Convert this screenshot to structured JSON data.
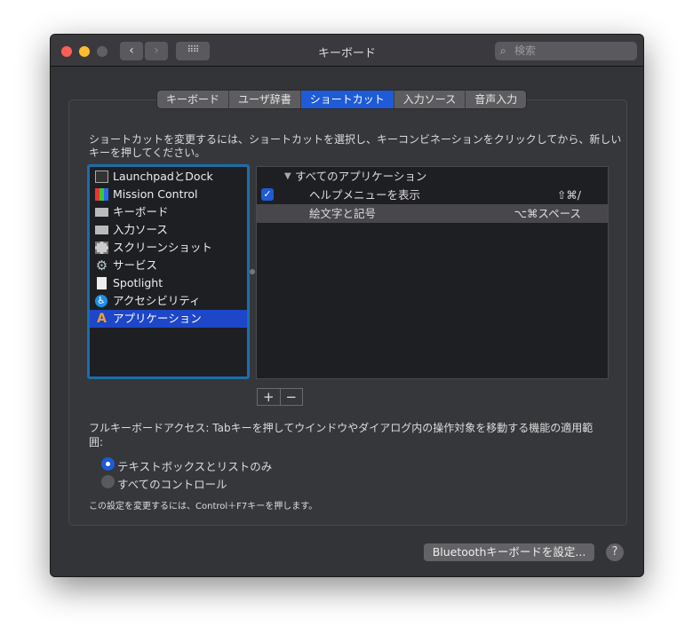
{
  "window": {
    "title": "キーボード",
    "search_placeholder": "検索"
  },
  "tabs": [
    {
      "label": "キーボード"
    },
    {
      "label": "ユーザ辞書"
    },
    {
      "label": "ショートカット",
      "active": true
    },
    {
      "label": "入力ソース"
    },
    {
      "label": "音声入力"
    }
  ],
  "instructions": "ショートカットを変更するには、ショートカットを選択し、キーコンビネーションをクリックしてから、新しいキーを押してください。",
  "categories": [
    {
      "label": "LaunchpadとDock",
      "icon": "launchpad-icon"
    },
    {
      "label": "Mission Control",
      "icon": "mission-control-icon"
    },
    {
      "label": "キーボード",
      "icon": "keyboard-icon"
    },
    {
      "label": "入力ソース",
      "icon": "keyboard-icon"
    },
    {
      "label": "スクリーンショット",
      "icon": "screenshot-icon"
    },
    {
      "label": "サービス",
      "icon": "gear-icon"
    },
    {
      "label": "Spotlight",
      "icon": "spotlight-icon"
    },
    {
      "label": "アクセシビリティ",
      "icon": "accessibility-icon"
    },
    {
      "label": "アプリケーション",
      "icon": "app-store-icon",
      "selected": true
    }
  ],
  "shortcuts": {
    "group": "すべてのアプリケーション",
    "items": [
      {
        "label": "ヘルプメニューを表示",
        "keys": "⇧⌘/",
        "checked": true
      },
      {
        "label": "絵文字と記号",
        "keys": "⌥⌘スペース",
        "checked": false
      }
    ]
  },
  "add_label": "+",
  "remove_label": "−",
  "full_access": {
    "description": "フルキーボードアクセス: Tabキーを押してウインドウやダイアログ内の操作対象を移動する機能の適用範囲:",
    "options": [
      {
        "label": "テキストボックスとリストのみ",
        "selected": true
      },
      {
        "label": "すべてのコントロール",
        "selected": false
      }
    ],
    "note": "この設定を変更するには、Control＋F7キーを押します。"
  },
  "bluetooth_button": "Bluetoothキーボードを設定...",
  "help_label": "?",
  "colors": {
    "accent": "#1f5bd6",
    "selection": "#1d46c9",
    "focus_ring": "#1b6ea8"
  }
}
